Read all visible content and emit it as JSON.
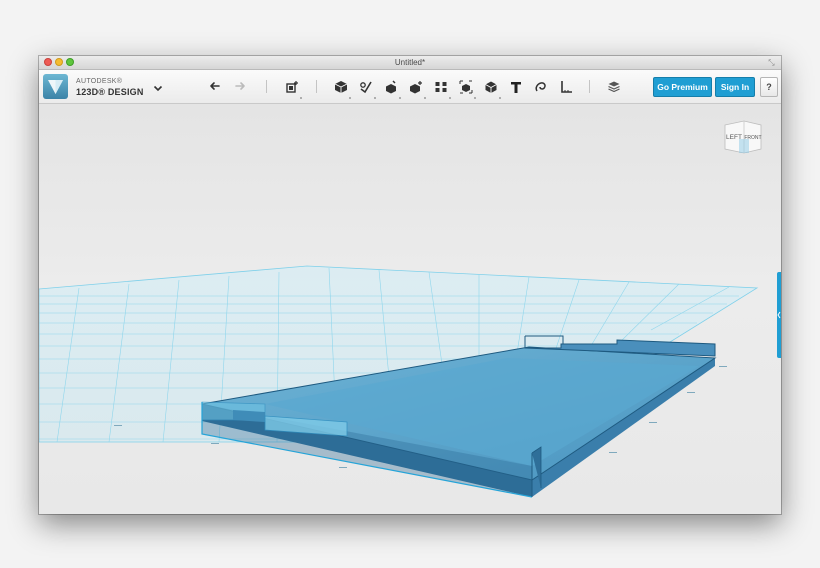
{
  "window": {
    "title": "Untitled*"
  },
  "brand": {
    "company": "AUTODESK®",
    "product": "123D® DESIGN"
  },
  "toolbar": {
    "menu_icon": "chevron-down-icon",
    "undo_icon": "undo-icon",
    "redo_icon": "redo-icon",
    "tools": [
      {
        "name": "transform-tool-icon"
      },
      {
        "name": "primitives-tool-icon"
      },
      {
        "name": "sketch-tool-icon"
      },
      {
        "name": "construct-tool-icon"
      },
      {
        "name": "modify-tool-icon"
      },
      {
        "name": "pattern-tool-icon"
      },
      {
        "name": "grouping-tool-icon"
      },
      {
        "name": "combine-tool-icon"
      },
      {
        "name": "text-tool-icon"
      },
      {
        "name": "snap-tool-icon"
      },
      {
        "name": "measure-tool-icon"
      },
      {
        "name": "material-tool-icon"
      }
    ],
    "premium_label": "Go Premium",
    "signin_label": "Sign In",
    "help_label": "?"
  },
  "viewcube": {
    "left_label": "LEFT",
    "front_label": "FRONT"
  },
  "colors": {
    "accent": "#1f9ed3",
    "model": "#4a90bd",
    "grid": "#7fd0ea"
  }
}
